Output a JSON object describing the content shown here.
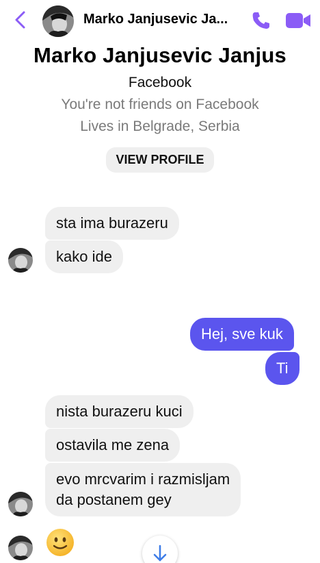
{
  "header": {
    "title": "Marko Janjusevic Ja...",
    "accent": "#8b5cf6"
  },
  "profile": {
    "name": "Marko Janjusevic Janjus",
    "source": "Facebook",
    "friend_status": "You're not friends on Facebook",
    "location": "Lives in Belgrade, Serbia",
    "view_profile_label": "VIEW PROFILE"
  },
  "messages": [
    {
      "from": "them",
      "text": "sta ima burazeru"
    },
    {
      "from": "them",
      "text": "kako ide"
    },
    {
      "from": "me",
      "text": "Hej, sve kuk"
    },
    {
      "from": "me",
      "text": "Ti"
    },
    {
      "from": "them",
      "text": "nista burazeru kuci"
    },
    {
      "from": "them",
      "text": "ostavila me zena"
    },
    {
      "from": "them",
      "text": "evo mrcvarim i razmisljam\nda postanem gey"
    },
    {
      "from": "them",
      "text": "🙂"
    }
  ],
  "colors": {
    "outgoing_bubble": "#5b55ee",
    "incoming_bubble": "#efefef"
  },
  "icons": [
    "back-chevron-icon",
    "phone-icon",
    "video-camera-icon",
    "smiley-emoji-icon",
    "arrow-down-icon"
  ]
}
